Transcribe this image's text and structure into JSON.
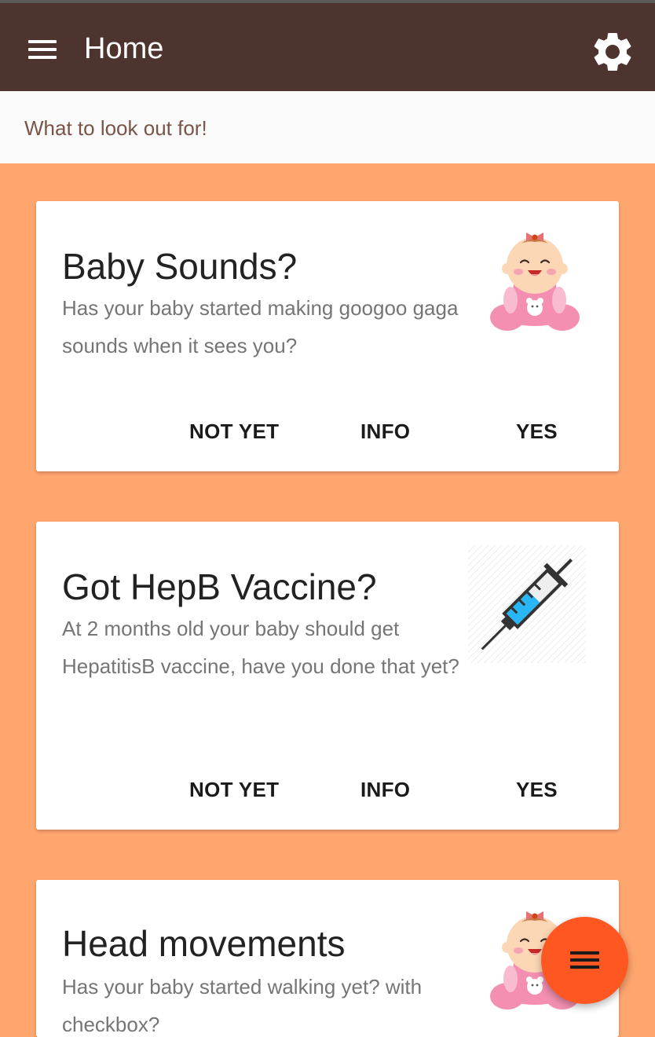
{
  "app_bar": {
    "title": "Home",
    "menu_icon": "hamburger-menu-icon",
    "settings_icon": "gear-icon",
    "color": "#4e342e"
  },
  "subheader": {
    "text": "What to look out for!"
  },
  "cards": [
    {
      "title": "Baby Sounds?",
      "description": "Has your baby started making googoo gaga sounds when it sees you?",
      "image": "baby-illustration",
      "actions": [
        "NOT YET",
        "INFO",
        "YES"
      ]
    },
    {
      "title": "Got HepB Vaccine?",
      "description": "At 2 months old your baby should get HepatitisB vaccine, have you done that yet?",
      "image": "syringe-illustration",
      "actions": [
        "NOT YET",
        "INFO",
        "YES"
      ]
    },
    {
      "title": "Head movements",
      "description": "Has your baby started walking yet? with checkbox?",
      "image": "baby-illustration",
      "actions": []
    }
  ],
  "fab": {
    "icon": "hamburger-menu-icon",
    "color": "#ff5722"
  },
  "colors": {
    "background": "#ffa66f",
    "subheader_text": "#795548"
  }
}
